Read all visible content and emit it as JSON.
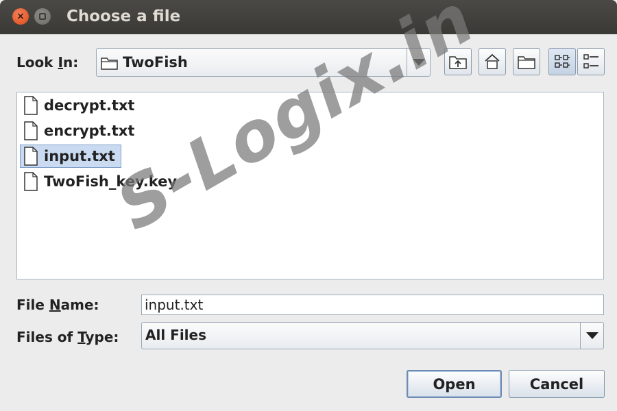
{
  "window": {
    "title": "Choose a file",
    "close_glyph": "×"
  },
  "look_in": {
    "label_prefix": "Look ",
    "label_mnemonic": "I",
    "label_suffix": "n:",
    "value": "TwoFish"
  },
  "toolbar": {
    "buttons": [
      "up-one-level-icon",
      "home-icon",
      "new-folder-icon",
      "list-view-icon",
      "details-view-icon"
    ]
  },
  "files": [
    {
      "name": "decrypt.txt",
      "selected": false
    },
    {
      "name": "encrypt.txt",
      "selected": false
    },
    {
      "name": "input.txt",
      "selected": true
    },
    {
      "name": "TwoFish_key.key",
      "selected": false
    }
  ],
  "file_name": {
    "label_prefix": "File ",
    "label_mnemonic": "N",
    "label_suffix": "ame:",
    "value": "input.txt"
  },
  "file_type": {
    "label_prefix": "Files of ",
    "label_mnemonic": "T",
    "label_suffix": "ype:",
    "value": "All Files"
  },
  "actions": {
    "open_label": "Open",
    "cancel_label": "Cancel"
  },
  "watermark": {
    "text": "S-Logix.in"
  },
  "colors": {
    "selection": "#c9daf1",
    "titlebar": "#3e3d39",
    "close_button": "#df4b16"
  }
}
